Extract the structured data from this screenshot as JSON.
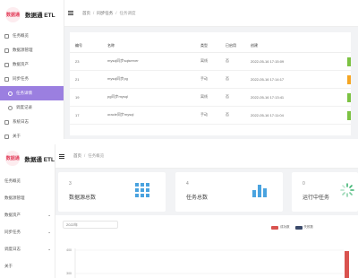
{
  "app": {
    "title": "数据通 ETL",
    "logo_text": "数据通"
  },
  "screen1": {
    "sidebar": {
      "items": [
        {
          "label": "任务概览"
        },
        {
          "label": "数据源管理"
        },
        {
          "label": "数据资产"
        },
        {
          "label": "同步任务"
        },
        {
          "label": "任务详情"
        },
        {
          "label": "调度记录"
        },
        {
          "label": "系统日志"
        },
        {
          "label": "关于"
        }
      ]
    },
    "breadcrumb": [
      "首页",
      "同步任务",
      "任务调度"
    ],
    "table": {
      "headers": [
        "编号",
        "名称",
        "类型",
        "已启用",
        "创建",
        ""
      ],
      "rows": [
        {
          "id": "23",
          "name": "mysql同步sqlserver",
          "type": "离线",
          "enabled": "否",
          "created": "2022-05-16 17:15:09"
        },
        {
          "id": "21",
          "name": "mysql同步pg",
          "type": "手动",
          "enabled": "否",
          "created": "2022-05-16 17:14:17"
        },
        {
          "id": "19",
          "name": "pg同步mysql",
          "type": "离线",
          "enabled": "否",
          "created": "2022-05-16 17:13:41"
        },
        {
          "id": "17",
          "name": "oracle同步mysql",
          "type": "手动",
          "enabled": "否",
          "created": "2022-05-16 17:11:04"
        }
      ],
      "status_colors": [
        "#7cc242",
        "#f5a623",
        "#7cc242",
        "#7cc242"
      ]
    }
  },
  "screen2": {
    "sidebar": {
      "items": [
        {
          "label": "任务概览"
        },
        {
          "label": "数据源管理"
        },
        {
          "label": "数据资产"
        },
        {
          "label": "同步任务"
        },
        {
          "label": "调度日志"
        },
        {
          "label": "关于"
        }
      ]
    },
    "breadcrumb": [
      "首页",
      "任务概览"
    ],
    "cards": [
      {
        "value": "3",
        "label": "数据源总数",
        "icon": "grid-icon",
        "color": "#4aa3df"
      },
      {
        "value": "4",
        "label": "任务总数",
        "icon": "bar-chart-icon",
        "color": "#4aa3df"
      },
      {
        "value": "0",
        "label": "运行中任务",
        "icon": "loading-spinner-icon",
        "color": "#3cb371"
      }
    ],
    "year_select": {
      "value": "2022",
      "placeholder": "2022年"
    },
    "chart_data": {
      "type": "bar",
      "title": "",
      "series": [
        {
          "name": "成功数",
          "color": "#d9534f"
        },
        {
          "name": "失败数",
          "color": "#3b4a6b"
        }
      ],
      "y_ticks": [
        "400",
        "300"
      ],
      "ylim": [
        0,
        400
      ]
    }
  },
  "colors": {
    "accent": "#9b7fe0",
    "brand": "#e23a57"
  }
}
